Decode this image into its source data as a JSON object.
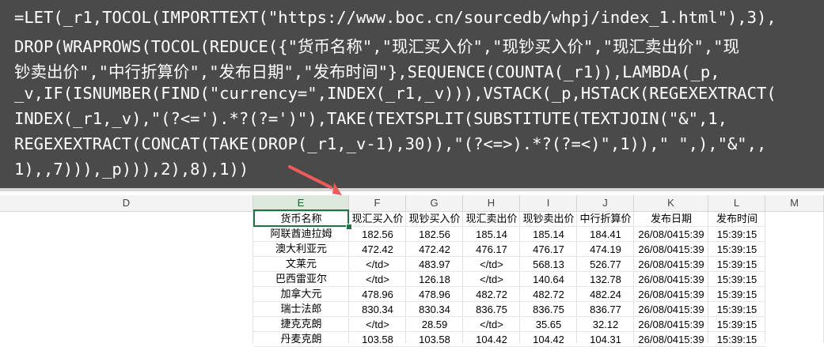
{
  "formula_lines": [
    "=LET(_r1,TOCOL(IMPORTTEXT(\"https://www.boc.cn/sourcedb/whpj/index_1.html\"),3),",
    "DROP(WRAPROWS(TOCOL(REDUCE({\"货币名称\",\"现汇买入价\",\"现钞买入价\",\"现汇卖出价\",\"现",
    "钞卖出价\",\"中行折算价\",\"发布日期\",\"发布时间\"},SEQUENCE(COUNTA(_r1)),LAMBDA(_p,",
    "_v,IF(ISNUMBER(FIND(\"currency=\",INDEX(_r1,_v))),VSTACK(_p,HSTACK(REGEXEXTRACT(",
    "INDEX(_r1,_v),\"(?<=').*?(?=')\"),TAKE(TEXTSPLIT(SUBSTITUTE(TEXTJOIN(\"&\",1,",
    "REGEXEXTRACT(CONCAT(TAKE(DROP(_r1,_v-1),30)),\"(?<=>).*?(?=<)\",1)),\" \",),\"&\",,",
    "1),,7))),_p))),2),8),1))"
  ],
  "column_headers": [
    "D",
    "E",
    "F",
    "G",
    "H",
    "I",
    "J",
    "K",
    "L",
    "M"
  ],
  "table": {
    "headers": [
      "货币名称",
      "现汇买入价",
      "现钞买入价",
      "现汇卖出价",
      "现钞卖出价",
      "中行折算价",
      "发布日期",
      "发布时间"
    ],
    "rows": [
      [
        "阿联酋迪拉姆",
        "182.56",
        "182.56",
        "185.14",
        "185.14",
        "184.41",
        "26/08/0415:39",
        "15:39:15"
      ],
      [
        "澳大利亚元",
        "472.42",
        "472.42",
        "476.17",
        "476.17",
        "474.19",
        "26/08/0415:39",
        "15:39:15"
      ],
      [
        "文莱元",
        "</td>",
        "483.97",
        "</td>",
        "568.13",
        "526.77",
        "26/08/0415:39",
        "15:39:15"
      ],
      [
        "巴西雷亚尔",
        "</td>",
        "126.18",
        "</td>",
        "140.64",
        "132.78",
        "26/08/0415:39",
        "15:39:15"
      ],
      [
        "加拿大元",
        "478.96",
        "478.96",
        "482.72",
        "482.72",
        "482.24",
        "26/08/0415:39",
        "15:39:15"
      ],
      [
        "瑞士法郎",
        "830.34",
        "830.34",
        "836.75",
        "836.75",
        "836.77",
        "26/08/0415:39",
        "15:39:15"
      ],
      [
        "捷克克朗",
        "</td>",
        "28.59",
        "</td>",
        "35.65",
        "32.12",
        "26/08/0415:39",
        "15:39:15"
      ],
      [
        "丹麦克朗",
        "103.58",
        "103.58",
        "104.42",
        "104.42",
        "104.31",
        "26/08/0415:39",
        "15:39:15"
      ]
    ]
  },
  "colors": {
    "formula_bg": "#4a4a4a",
    "selection": "#217346",
    "arrow": "#f05a5a"
  }
}
